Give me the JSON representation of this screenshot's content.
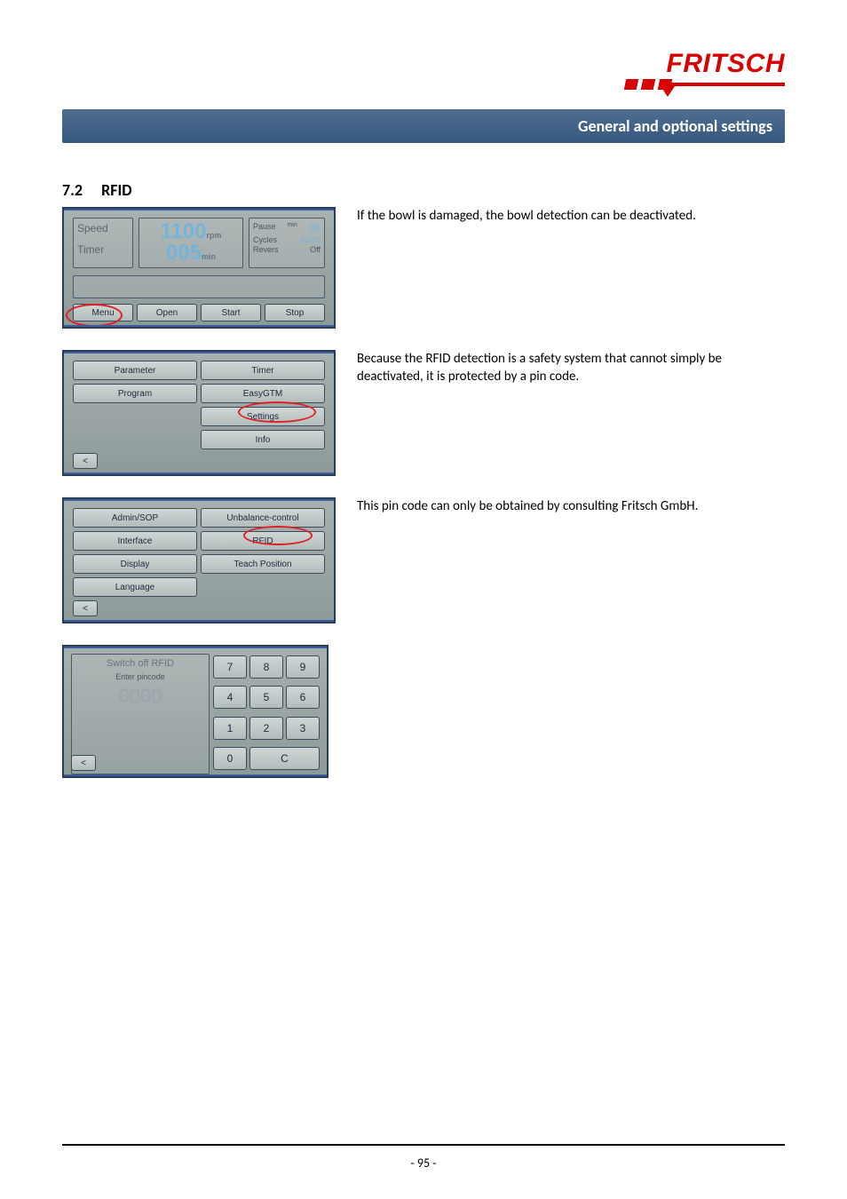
{
  "logo": {
    "brand": "FRITSCH"
  },
  "banner": {
    "title": "General and optional settings"
  },
  "section": {
    "number": "7.2",
    "title": "RFID"
  },
  "paragraphs": {
    "p1": "If the bowl is damaged, the bowl detection can be deactivated.",
    "p2": "Because the RFID detection is a safety system that cannot simply be deactivated, it is protected by a pin code.",
    "p3": "This pin code can only be obtained by consulting Fritsch GmbH."
  },
  "screen1": {
    "speed_label": "Speed",
    "timer_label": "Timer",
    "speed_value": "1100",
    "speed_unit": "rpm",
    "timer_value": "005",
    "timer_unit": "min",
    "pause_label": "Pause",
    "pause_unit": "min",
    "pause_value": "00",
    "cycles_label": "Cycles",
    "cycles_value": "01/01",
    "revers_label": "Revers",
    "revers_value": "Off",
    "buttons": {
      "menu": "Menu",
      "open": "Open",
      "start": "Start",
      "stop": "Stop"
    }
  },
  "screen2": {
    "parameter": "Parameter",
    "timer": "Timer",
    "program": "Program",
    "easygtm": "EasyGTM",
    "settings": "Settings",
    "info": "Info",
    "back": "<"
  },
  "screen3": {
    "admin_sop": "Admin/SOP",
    "unbalance": "Unbalance-control",
    "interface": "Interface",
    "rfid": "RFID",
    "display": "Display",
    "teach": "Teach Position",
    "language": "Language",
    "back": "<"
  },
  "screen4": {
    "title": "Switch off RFID",
    "prompt": "Enter pincode",
    "value": "0000",
    "keys": [
      "7",
      "8",
      "9",
      "4",
      "5",
      "6",
      "1",
      "2",
      "3"
    ],
    "zero": "0",
    "clear": "C",
    "back": "<"
  },
  "footer": {
    "page": "- 95 -"
  }
}
